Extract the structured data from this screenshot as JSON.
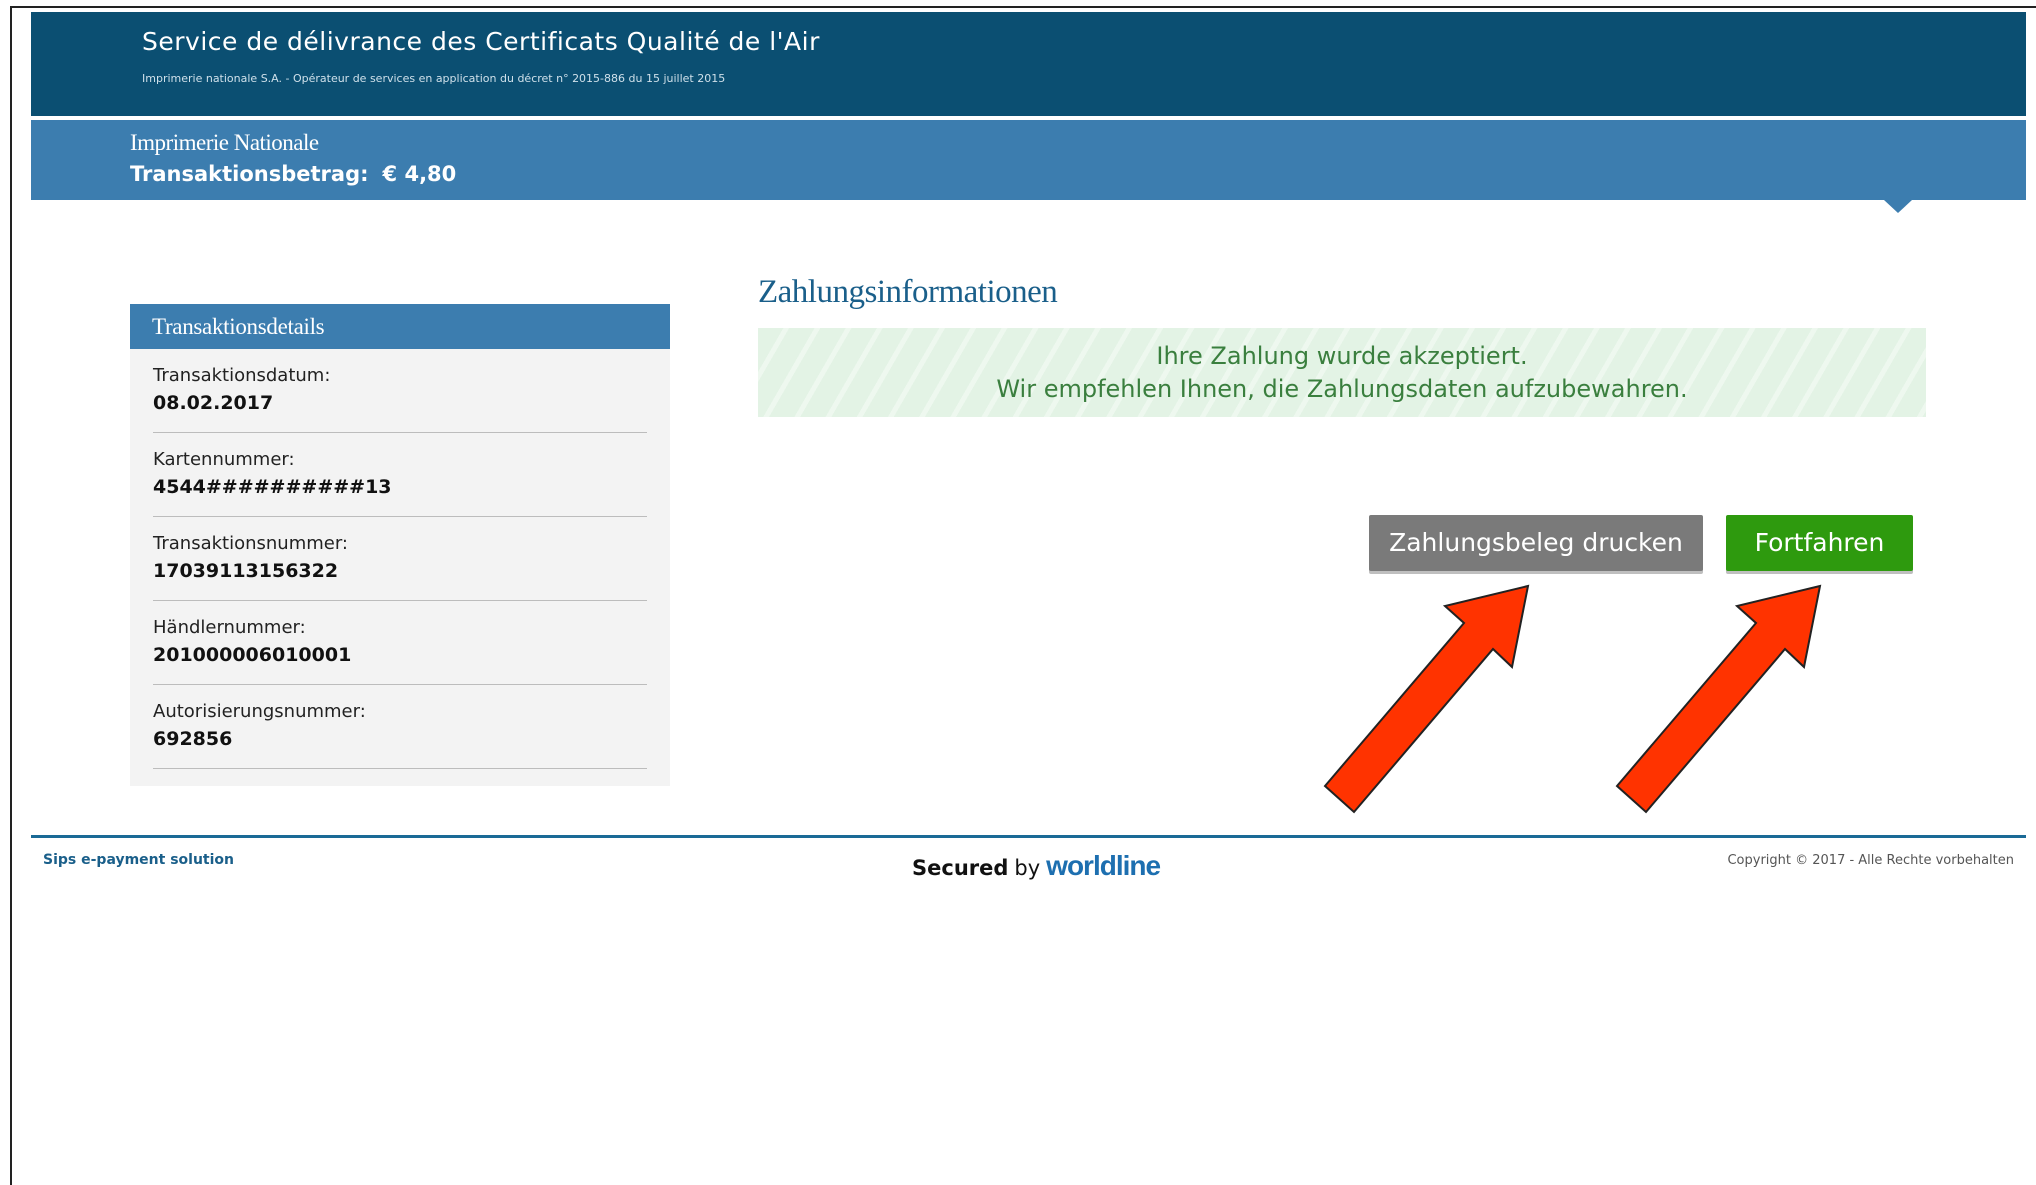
{
  "header": {
    "title": "Service de délivrance des Certificats Qualité de l'Air",
    "subtitle": "Imprimerie nationale S.A. - Opérateur de services en application du décret n° 2015-886 du 15 juillet 2015"
  },
  "merchant": {
    "name": "Imprimerie Nationale",
    "amount_label": "Transaktionsbetrag:",
    "amount_value": "€ 4,80"
  },
  "details": {
    "heading": "Transaktionsdetails",
    "items": [
      {
        "label": "Transaktionsdatum:",
        "value": "08.02.2017"
      },
      {
        "label": "Kartennummer:",
        "value": "4544##########13"
      },
      {
        "label": "Transaktionsnummer:",
        "value": "17039113156322"
      },
      {
        "label": "Händlernummer:",
        "value": "201000006010001"
      },
      {
        "label": "Autorisierungsnummer:",
        "value": "692856"
      }
    ]
  },
  "main": {
    "title": "Zahlungsinformationen",
    "success_line1": "Ihre Zahlung wurde akzeptiert.",
    "success_line2": "Wir empfehlen Ihnen, die Zahlungsdaten aufzubewahren.",
    "print_button": "Zahlungsbeleg drucken",
    "continue_button": "Fortfahren"
  },
  "footer": {
    "left": "Sips e-payment solution",
    "secured": "Secured",
    "by": "by",
    "brand": "worldline",
    "copyright": "Copyright © 2017 - Alle Rechte vorbehalten"
  },
  "colors": {
    "header_dark": "#0b4f72",
    "header_band": "#3c7daf",
    "success_text": "#3a7f3e",
    "button_print": "#7a7a7a",
    "button_continue": "#2e9a0e",
    "annotation_arrow": "#ff3300"
  }
}
